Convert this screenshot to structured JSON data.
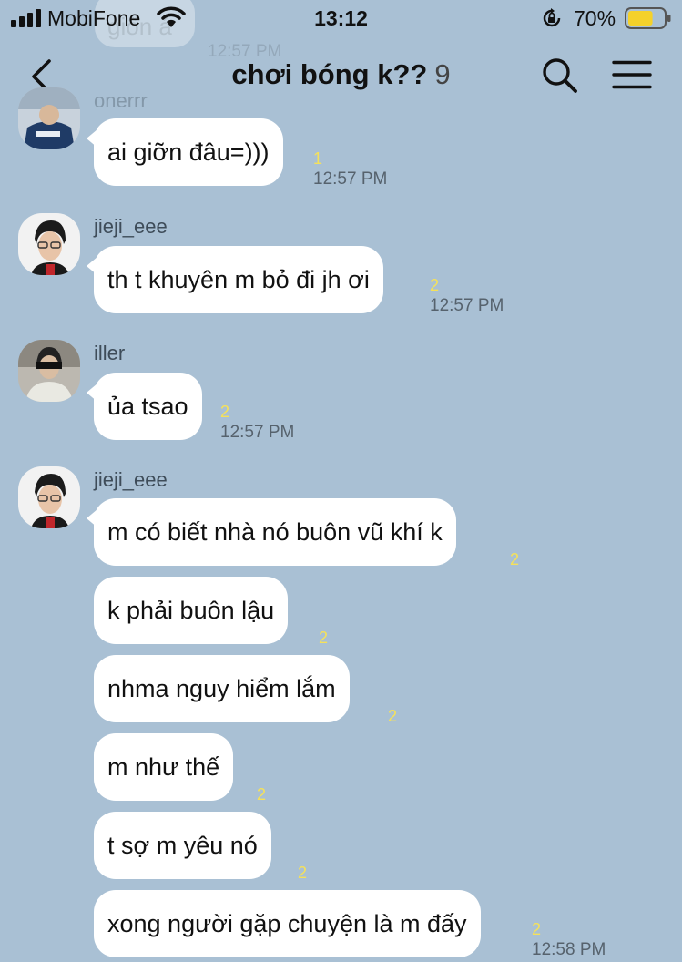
{
  "status_bar": {
    "carrier": "MobiFone",
    "time": "13:12",
    "battery_percent": "70%",
    "battery_level": 0.7,
    "battery_color": "#f4d12a"
  },
  "ghost_message": {
    "text": "giốn á",
    "time": "12:57 PM"
  },
  "header": {
    "title": "chơi bóng k??",
    "member_count": "9",
    "back_icon": "chevron-left-icon",
    "search_icon": "search-icon",
    "menu_icon": "hamburger-menu-icon"
  },
  "messages": [
    {
      "sender": "onerrr",
      "text": "ai giỡn đâu=)))",
      "unread": "1",
      "time": "12:57 PM"
    },
    {
      "sender": "jieji_eee",
      "text": "th t khuyên m bỏ đi jh ơi",
      "unread": "2",
      "time": "12:57 PM"
    },
    {
      "sender": "iller",
      "text": "ủa tsao",
      "unread": "2",
      "time": "12:57 PM"
    },
    {
      "sender": "jieji_eee",
      "text": "m có biết nhà nó buôn vũ khí k",
      "unread": "2"
    },
    {
      "text": "k phải buôn lậu",
      "unread": "2"
    },
    {
      "text": "nhma nguy hiểm lắm",
      "unread": "2"
    },
    {
      "text": "m như thế",
      "unread": "2"
    },
    {
      "text": "t sợ m yêu nó",
      "unread": "2"
    },
    {
      "text": "xong người gặp chuyện là m đấy",
      "unread": "2",
      "time": "12:58 PM"
    }
  ],
  "colors": {
    "background": "#a9c0d4",
    "bubble": "#ffffff",
    "unread_count": "#f5e15a"
  }
}
